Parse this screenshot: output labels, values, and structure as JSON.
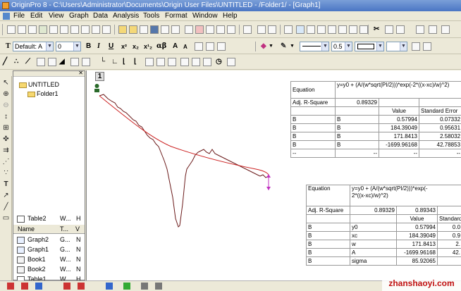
{
  "window": {
    "title": "OriginPro 8 - C:\\Users\\Administrator\\Documents\\Origin User Files\\UNTITLED - /Folder1/ - [Graph1]"
  },
  "menu": [
    "File",
    "Edit",
    "View",
    "Graph",
    "Data",
    "Analysis",
    "Tools",
    "Format",
    "Window",
    "Help"
  ],
  "format_toolbar": {
    "font_label": "Default: A",
    "font_size": "0",
    "bold_label": "B",
    "italic_label": "I",
    "underline_label": "U",
    "line_width": "0.5"
  },
  "explorer": {
    "root": "UNTITLED",
    "folder": "Folder1",
    "columns": [
      "Name",
      "T...",
      "V"
    ],
    "items": [
      {
        "name": "Graph2",
        "type": "G...",
        "v": "N",
        "icon": "graph-icon"
      },
      {
        "name": "Graph1",
        "type": "G...",
        "v": "N",
        "icon": "graph-icon"
      },
      {
        "name": "Book1",
        "type": "W...",
        "v": "N",
        "icon": "workbook-icon"
      },
      {
        "name": "Book2",
        "type": "W...",
        "v": "N",
        "icon": "workbook-icon"
      },
      {
        "name": "Table1",
        "type": "W...",
        "v": "H",
        "icon": "table-icon"
      },
      {
        "name": "Table2",
        "type": "W...",
        "v": "H",
        "icon": "table-icon"
      }
    ]
  },
  "graph": {
    "layer": "1",
    "data_color": "#6b1a1a",
    "fit_color": "#cc2222"
  },
  "table1": {
    "equation_label": "Equation",
    "equation": "y=y0 + (A/(w*sqrt(PI/2)))*exp(-2*((x-xc)/w)^2)",
    "adj_r_label": "Adj. R-Square",
    "adj_r": "0.89329",
    "col_value": "Value",
    "col_err": "Standard Error",
    "rows": [
      [
        "B",
        "B",
        "0.57994",
        "0.07332"
      ],
      [
        "B",
        "B",
        "184.39049",
        "0.95631"
      ],
      [
        "B",
        "B",
        "171.8413",
        "2.58032"
      ],
      [
        "B",
        "B",
        "-1699.96168",
        "42.78853"
      ],
      [
        "--",
        "--",
        "--",
        "--"
      ]
    ]
  },
  "table2": {
    "equation_label": "Equation",
    "equation_line1": "y=y0 + (A/(w*sqrt(PI/2)))*exp(-",
    "equation_line2": "2*((x-xc)/w)^2)",
    "adj_r_label": "Adj. R-Square",
    "adj_r_1": "0.89329",
    "adj_r_2": "0.89343",
    "col_value": "Value",
    "col_std": "Standard",
    "rows": [
      [
        "B",
        "y0",
        "0.57994",
        "0.0"
      ],
      [
        "B",
        "xc",
        "184.39049",
        "0.9"
      ],
      [
        "B",
        "w",
        "171.8413",
        "2."
      ],
      [
        "B",
        "A",
        "-1699.96168",
        "42."
      ],
      [
        "B",
        "sigma",
        "85.92065",
        ""
      ]
    ]
  },
  "watermark": "zhanshaoyi.com"
}
